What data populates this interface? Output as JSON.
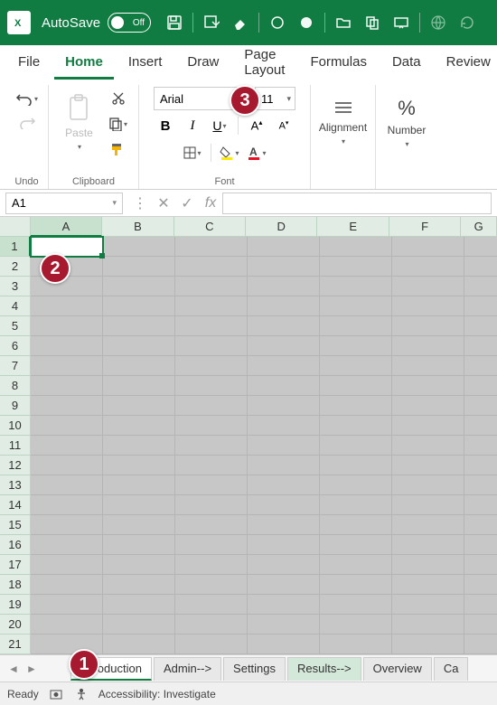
{
  "titlebar": {
    "autosave_label": "AutoSave",
    "autosave_state": "Off"
  },
  "tabs": [
    "File",
    "Home",
    "Insert",
    "Draw",
    "Page Layout",
    "Formulas",
    "Data",
    "Review"
  ],
  "active_tab": "Home",
  "ribbon": {
    "undo_label": "Undo",
    "clipboard_label": "Clipboard",
    "paste_label": "Paste",
    "font_label": "Font",
    "font_name": "Arial",
    "font_size": "11",
    "alignment_label": "Alignment",
    "number_label": "Number"
  },
  "formula": {
    "name_box": "A1",
    "fx_label": "fx",
    "value": ""
  },
  "grid": {
    "columns": [
      "A",
      "B",
      "C",
      "D",
      "E",
      "F",
      "G"
    ],
    "row_count": 21,
    "active_cell": "A1"
  },
  "sheet_tabs": [
    {
      "label": "Introduction",
      "active": true,
      "green": false
    },
    {
      "label": "Admin-->",
      "active": false,
      "green": false
    },
    {
      "label": "Settings",
      "active": false,
      "green": false
    },
    {
      "label": "Results-->",
      "active": false,
      "green": true
    },
    {
      "label": "Overview",
      "active": false,
      "green": false
    },
    {
      "label": "Ca",
      "active": false,
      "green": false
    }
  ],
  "status": {
    "ready": "Ready",
    "accessibility": "Accessibility: Investigate"
  },
  "callouts": {
    "c1": "1",
    "c2": "2",
    "c3": "3"
  }
}
